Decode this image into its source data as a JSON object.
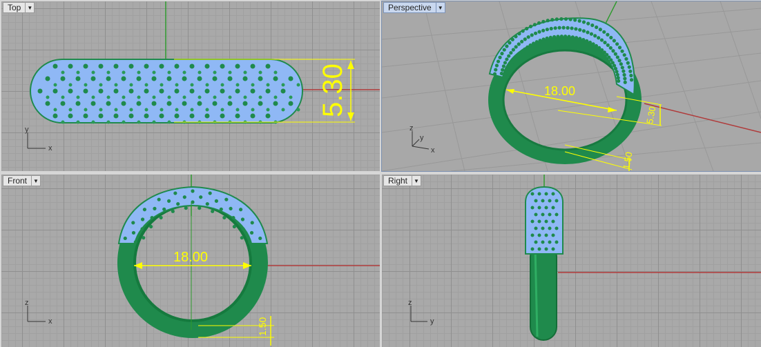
{
  "viewports": {
    "top": {
      "label": "Top",
      "dimension": "5.30",
      "axis_h": "x",
      "axis_v": "y"
    },
    "perspective": {
      "label": "Perspective",
      "dim_diameter": "18.00",
      "dim_height": "5.30",
      "dim_thickness": "1.50",
      "axis_h": "x",
      "axis_v": "z",
      "axis_d": "y"
    },
    "front": {
      "label": "Front",
      "dim_diameter": "18.00",
      "dim_thickness": "1.50",
      "axis_h": "x",
      "axis_v": "z"
    },
    "right": {
      "label": "Right",
      "axis_h": "y",
      "axis_v": "z"
    }
  },
  "colors": {
    "background": "#a9a9a9",
    "dimension": "#ffff00",
    "ring_metal": "#1f8a4c",
    "gem": "#8fb8f5",
    "x_axis": "#b03a3a",
    "y_axis": "#2e9a2e"
  },
  "icons": {
    "tab_menu": "dropdown-triangle-icon"
  }
}
